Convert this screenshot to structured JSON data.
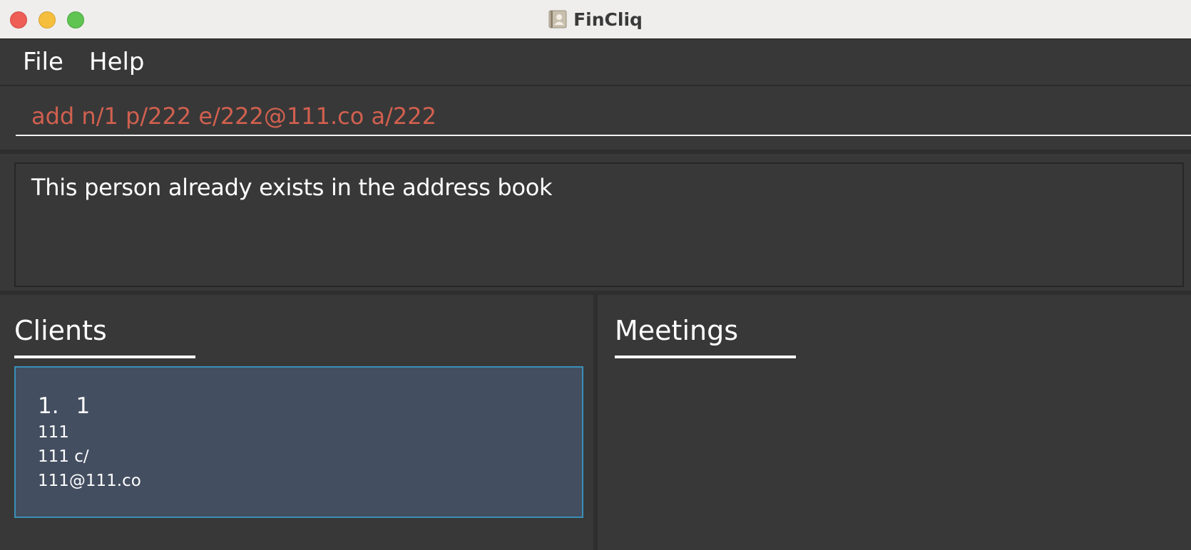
{
  "window": {
    "title": "FinCliq",
    "controls": {
      "close_color": "#ee5e57",
      "minimize_color": "#f5be3c",
      "maximize_color": "#5fc452"
    },
    "app_icon": "address-book-icon"
  },
  "menu": {
    "items": [
      {
        "label": "File"
      },
      {
        "label": "Help"
      }
    ]
  },
  "command": {
    "value": "add n/1 p/222 e/222@111.co a/222",
    "text_color": "#d1604f"
  },
  "result": {
    "message": "This person already exists in the address book"
  },
  "clients": {
    "heading": "Clients",
    "items": [
      {
        "index": "1.",
        "name": "1",
        "phone": "111",
        "address": "111 c/",
        "email": "111@111.co"
      }
    ],
    "selected_color": "#434e60",
    "selected_border": "#3a8fb7"
  },
  "meetings": {
    "heading": "Meetings",
    "items": []
  }
}
